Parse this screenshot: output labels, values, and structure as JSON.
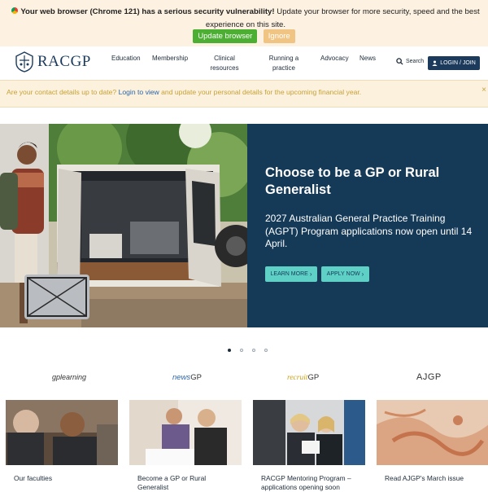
{
  "browser_warning": {
    "bold_text": "Your web browser (Chrome 121) has a serious security vulnerability!",
    "text": "Update your browser for more security, speed and the best experience on this site.",
    "update_label": "Update browser",
    "ignore_label": "Ignore"
  },
  "header": {
    "logo_text": "RACGP",
    "nav": [
      {
        "label": "Education"
      },
      {
        "label": "Membership"
      },
      {
        "label": "Clinical resources"
      },
      {
        "label": "Running a practice"
      },
      {
        "label": "Advocacy"
      },
      {
        "label": "News"
      }
    ],
    "search_label": "Search",
    "login_label": "LOGIN / JOIN"
  },
  "notice": {
    "prefix": "Are your contact details up to date?",
    "link": "Login to view",
    "suffix": "and update your personal details for the upcoming financial year.",
    "close": "×"
  },
  "hero": {
    "title": "Choose to be a GP or Rural Generalist",
    "text": "2027 Australian General Practice Training (AGPT) Program applications now open until 14 April.",
    "learn_more": "LEARN MORE",
    "apply_now": "APPLY NOW"
  },
  "brands": {
    "gplearning": "gplearning",
    "newsgp_a": "news",
    "newsgp_b": "GP",
    "recruitgp_a": "recruit",
    "recruitgp_b": "GP",
    "ajgp": "AJGP"
  },
  "cards": [
    {
      "title": "Our faculties"
    },
    {
      "title": "Become a GP or Rural Generalist"
    },
    {
      "title": "RACGP Mentoring Program – applications opening soon"
    },
    {
      "title": "Read AJGP's March issue"
    }
  ],
  "colors": {
    "navy": "#153a58",
    "teal": "#5fd0c5",
    "update_green": "#4cae33",
    "ignore_orange": "#f0c584"
  }
}
